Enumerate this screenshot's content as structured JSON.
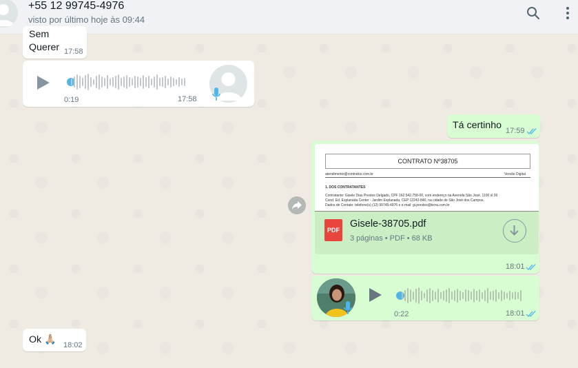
{
  "header": {
    "contact_name": "+55 12 99745-4976",
    "last_seen": "visto por último hoje às 09:44",
    "icons": [
      "user-avatar-icon",
      "search-icon",
      "menu-icon"
    ]
  },
  "messages": {
    "m1": {
      "text_line1": "Sem",
      "text_line2": "Querer",
      "time": "17:58"
    },
    "m2": {
      "duration": "0:19",
      "time": "17:58"
    },
    "m3": {
      "text": "Tá certinho",
      "time": "17:59"
    },
    "m4": {
      "preview_title": "CONTRATO Nº38705",
      "preview_lines": [
        "atendimento@contratos.com.br",
        "Versão Digital",
        "1. DOS CONTRATANTES",
        "Contratante: Gisele Dias Prestes Delgado, CPF 162.542.758-00, com endereço na Avenida São José, 1100 sl 36",
        "Cond. Ed. Esplanada Center - Jardim Esplanada, CEP 12242-840, na cidade de São José dos Campos.",
        "Dados de Contato: telefone(s) (12) 99745-4976 e e-mail: gi.prestes@terra.com.br"
      ],
      "file_name": "Gisele-38705.pdf",
      "file_badge": "PDF",
      "file_meta": "3 páginas • PDF • 68 KB",
      "time": "18:01"
    },
    "m5": {
      "duration": "0:22",
      "time": "18:01"
    },
    "m6": {
      "text": "Ok 🙏🏼",
      "time": "18:02"
    }
  },
  "colors": {
    "chat_bg": "#efeae2",
    "incoming": "#ffffff",
    "outgoing": "#d9fdd3",
    "read_ticks": "#53bdeb",
    "voice_dot": "#4fb6ec",
    "pdf_red": "#e8453c"
  }
}
